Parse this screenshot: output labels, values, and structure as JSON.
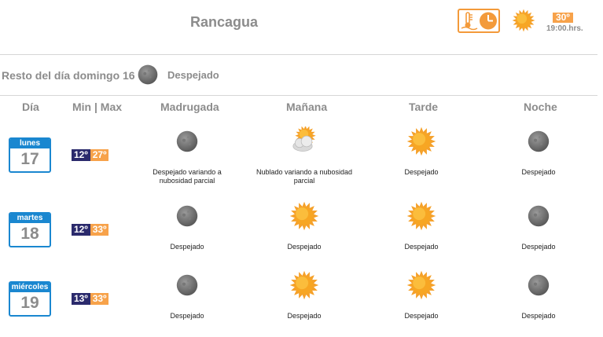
{
  "header": {
    "city": "Rancagua",
    "current_temp": "30º",
    "current_time": "19:00.hrs.",
    "thermo_clock_icon": "thermometer-clock-icon",
    "current_icon": "sun-icon"
  },
  "rest_of_day": {
    "label": "Resto del día domingo 16",
    "icon": "moon-clear-icon",
    "description": "Despejado"
  },
  "columns": {
    "day": "Día",
    "minmax": "Min | Max",
    "madrugada": "Madrugada",
    "manana": "Mañana",
    "tarde": "Tarde",
    "noche": "Noche"
  },
  "days": [
    {
      "weekday": "lunes",
      "date": "17",
      "min": "12º",
      "max": "27º",
      "madrugada": {
        "icon": "moon-clear-icon",
        "text": "Despejado variando a nubosidad parcial"
      },
      "manana": {
        "icon": "sun-cloud-icon",
        "text": "Nublado variando a nubosidad parcial"
      },
      "tarde": {
        "icon": "sun-icon",
        "text": "Despejado"
      },
      "noche": {
        "icon": "moon-clear-icon",
        "text": "Despejado"
      }
    },
    {
      "weekday": "martes",
      "date": "18",
      "min": "12º",
      "max": "33º",
      "madrugada": {
        "icon": "moon-clear-icon",
        "text": "Despejado"
      },
      "manana": {
        "icon": "sun-icon",
        "text": "Despejado"
      },
      "tarde": {
        "icon": "sun-icon",
        "text": "Despejado"
      },
      "noche": {
        "icon": "moon-clear-icon",
        "text": "Despejado"
      }
    },
    {
      "weekday": "miércoles",
      "date": "19",
      "min": "13º",
      "max": "33º",
      "madrugada": {
        "icon": "moon-clear-icon",
        "text": "Despejado"
      },
      "manana": {
        "icon": "sun-icon",
        "text": "Despejado"
      },
      "tarde": {
        "icon": "sun-icon",
        "text": "Despejado"
      },
      "noche": {
        "icon": "moon-clear-icon",
        "text": "Despejado"
      }
    }
  ],
  "colors": {
    "accent_orange": "#f7a24a",
    "accent_blue": "#1a87d0",
    "min_navy": "#2b2a6c",
    "text_gray": "#8c8c8c"
  }
}
